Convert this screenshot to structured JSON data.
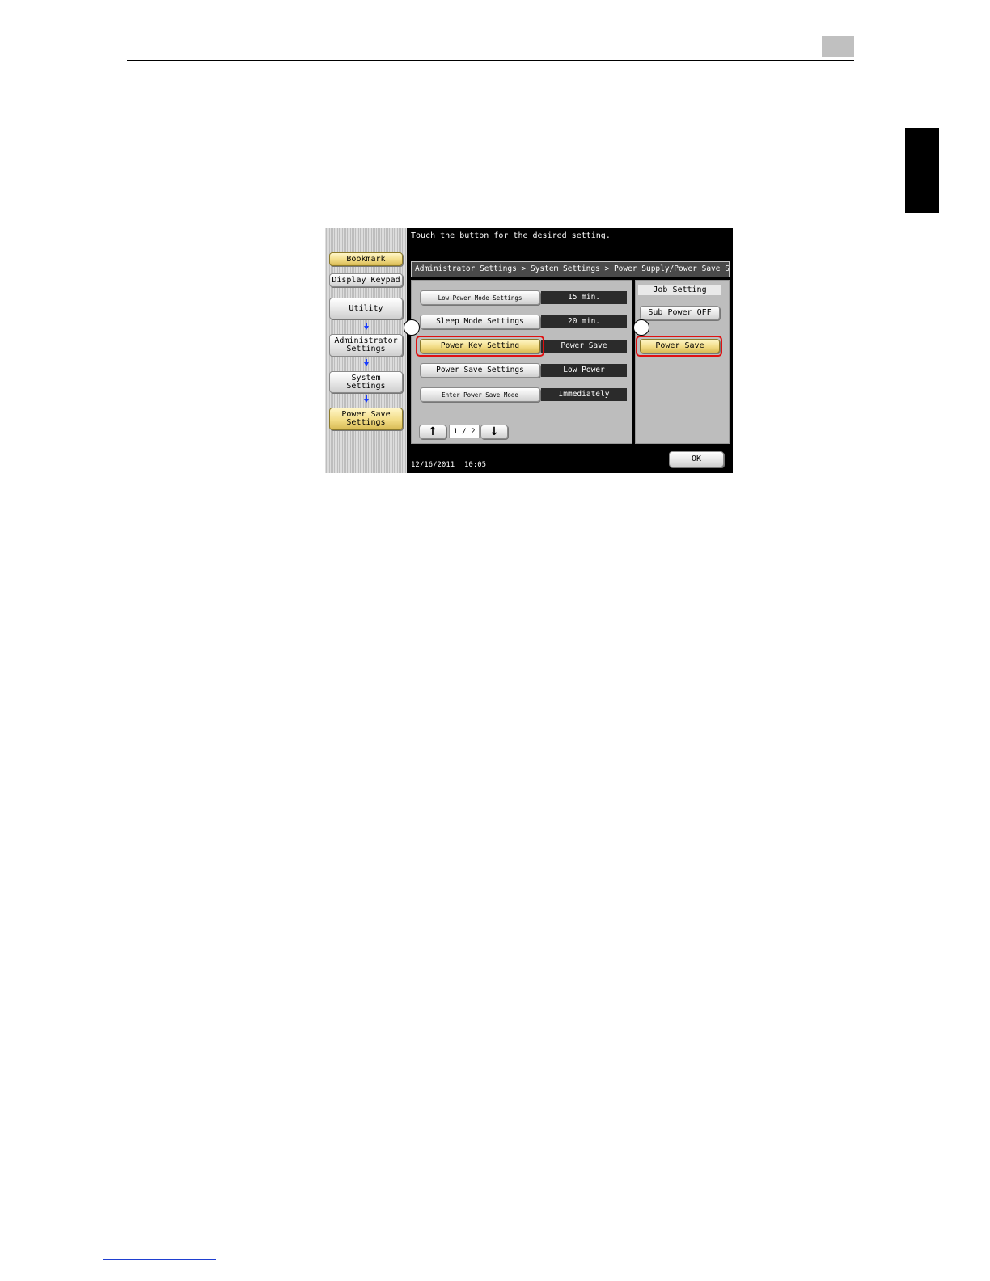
{
  "screen": {
    "message": "Touch the button for the desired setting.",
    "breadcrumb": "Administrator Settings > System Settings > Power Supply/Power Save Settings",
    "left_nav": {
      "bookmark": "Bookmark",
      "display_keypad": "Display Keypad",
      "utility": "Utility",
      "administrator_settings": "Administrator Settings",
      "system_settings": "System Settings",
      "power_save_settings": "Power Save Settings"
    },
    "rows": [
      {
        "label": "Low Power Mode Settings",
        "value": "15 min."
      },
      {
        "label": "Sleep Mode Settings",
        "value": "20 min."
      },
      {
        "label": "Power Key Setting",
        "value": "Power Save"
      },
      {
        "label": "Power Save Settings",
        "value": "Low Power"
      },
      {
        "label": "Enter Power Save Mode",
        "value": "Immediately"
      }
    ],
    "pagination": {
      "indicator": "1 / 2",
      "up_icon": "up-arrow-icon",
      "down_icon": "down-arrow-icon"
    },
    "job_setting": {
      "title": "Job Setting",
      "options": [
        "Sub Power OFF",
        "Power Save"
      ],
      "selected": "Power Save"
    },
    "status": {
      "date": "12/16/2011",
      "time": "10:05"
    },
    "ok_label": "OK"
  },
  "colors": {
    "highlight_gold": "#f2dc86",
    "callout_outline": "#e01010",
    "nav_arrow": "#1a3cff"
  }
}
